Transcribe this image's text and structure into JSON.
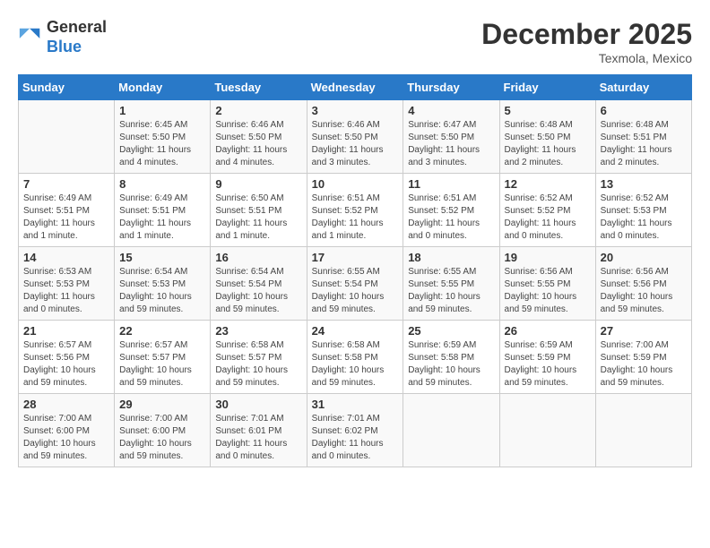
{
  "header": {
    "logo_general": "General",
    "logo_blue": "Blue",
    "month_title": "December 2025",
    "subtitle": "Texmola, Mexico"
  },
  "days_of_week": [
    "Sunday",
    "Monday",
    "Tuesday",
    "Wednesday",
    "Thursday",
    "Friday",
    "Saturday"
  ],
  "weeks": [
    [
      {
        "day": "",
        "info": ""
      },
      {
        "day": "1",
        "info": "Sunrise: 6:45 AM\nSunset: 5:50 PM\nDaylight: 11 hours and 4 minutes."
      },
      {
        "day": "2",
        "info": "Sunrise: 6:46 AM\nSunset: 5:50 PM\nDaylight: 11 hours and 4 minutes."
      },
      {
        "day": "3",
        "info": "Sunrise: 6:46 AM\nSunset: 5:50 PM\nDaylight: 11 hours and 3 minutes."
      },
      {
        "day": "4",
        "info": "Sunrise: 6:47 AM\nSunset: 5:50 PM\nDaylight: 11 hours and 3 minutes."
      },
      {
        "day": "5",
        "info": "Sunrise: 6:48 AM\nSunset: 5:50 PM\nDaylight: 11 hours and 2 minutes."
      },
      {
        "day": "6",
        "info": "Sunrise: 6:48 AM\nSunset: 5:51 PM\nDaylight: 11 hours and 2 minutes."
      }
    ],
    [
      {
        "day": "7",
        "info": "Sunrise: 6:49 AM\nSunset: 5:51 PM\nDaylight: 11 hours and 1 minute."
      },
      {
        "day": "8",
        "info": "Sunrise: 6:49 AM\nSunset: 5:51 PM\nDaylight: 11 hours and 1 minute."
      },
      {
        "day": "9",
        "info": "Sunrise: 6:50 AM\nSunset: 5:51 PM\nDaylight: 11 hours and 1 minute."
      },
      {
        "day": "10",
        "info": "Sunrise: 6:51 AM\nSunset: 5:52 PM\nDaylight: 11 hours and 1 minute."
      },
      {
        "day": "11",
        "info": "Sunrise: 6:51 AM\nSunset: 5:52 PM\nDaylight: 11 hours and 0 minutes."
      },
      {
        "day": "12",
        "info": "Sunrise: 6:52 AM\nSunset: 5:52 PM\nDaylight: 11 hours and 0 minutes."
      },
      {
        "day": "13",
        "info": "Sunrise: 6:52 AM\nSunset: 5:53 PM\nDaylight: 11 hours and 0 minutes."
      }
    ],
    [
      {
        "day": "14",
        "info": "Sunrise: 6:53 AM\nSunset: 5:53 PM\nDaylight: 11 hours and 0 minutes."
      },
      {
        "day": "15",
        "info": "Sunrise: 6:54 AM\nSunset: 5:53 PM\nDaylight: 10 hours and 59 minutes."
      },
      {
        "day": "16",
        "info": "Sunrise: 6:54 AM\nSunset: 5:54 PM\nDaylight: 10 hours and 59 minutes."
      },
      {
        "day": "17",
        "info": "Sunrise: 6:55 AM\nSunset: 5:54 PM\nDaylight: 10 hours and 59 minutes."
      },
      {
        "day": "18",
        "info": "Sunrise: 6:55 AM\nSunset: 5:55 PM\nDaylight: 10 hours and 59 minutes."
      },
      {
        "day": "19",
        "info": "Sunrise: 6:56 AM\nSunset: 5:55 PM\nDaylight: 10 hours and 59 minutes."
      },
      {
        "day": "20",
        "info": "Sunrise: 6:56 AM\nSunset: 5:56 PM\nDaylight: 10 hours and 59 minutes."
      }
    ],
    [
      {
        "day": "21",
        "info": "Sunrise: 6:57 AM\nSunset: 5:56 PM\nDaylight: 10 hours and 59 minutes."
      },
      {
        "day": "22",
        "info": "Sunrise: 6:57 AM\nSunset: 5:57 PM\nDaylight: 10 hours and 59 minutes."
      },
      {
        "day": "23",
        "info": "Sunrise: 6:58 AM\nSunset: 5:57 PM\nDaylight: 10 hours and 59 minutes."
      },
      {
        "day": "24",
        "info": "Sunrise: 6:58 AM\nSunset: 5:58 PM\nDaylight: 10 hours and 59 minutes."
      },
      {
        "day": "25",
        "info": "Sunrise: 6:59 AM\nSunset: 5:58 PM\nDaylight: 10 hours and 59 minutes."
      },
      {
        "day": "26",
        "info": "Sunrise: 6:59 AM\nSunset: 5:59 PM\nDaylight: 10 hours and 59 minutes."
      },
      {
        "day": "27",
        "info": "Sunrise: 7:00 AM\nSunset: 5:59 PM\nDaylight: 10 hours and 59 minutes."
      }
    ],
    [
      {
        "day": "28",
        "info": "Sunrise: 7:00 AM\nSunset: 6:00 PM\nDaylight: 10 hours and 59 minutes."
      },
      {
        "day": "29",
        "info": "Sunrise: 7:00 AM\nSunset: 6:00 PM\nDaylight: 10 hours and 59 minutes."
      },
      {
        "day": "30",
        "info": "Sunrise: 7:01 AM\nSunset: 6:01 PM\nDaylight: 11 hours and 0 minutes."
      },
      {
        "day": "31",
        "info": "Sunrise: 7:01 AM\nSunset: 6:02 PM\nDaylight: 11 hours and 0 minutes."
      },
      {
        "day": "",
        "info": ""
      },
      {
        "day": "",
        "info": ""
      },
      {
        "day": "",
        "info": ""
      }
    ]
  ]
}
